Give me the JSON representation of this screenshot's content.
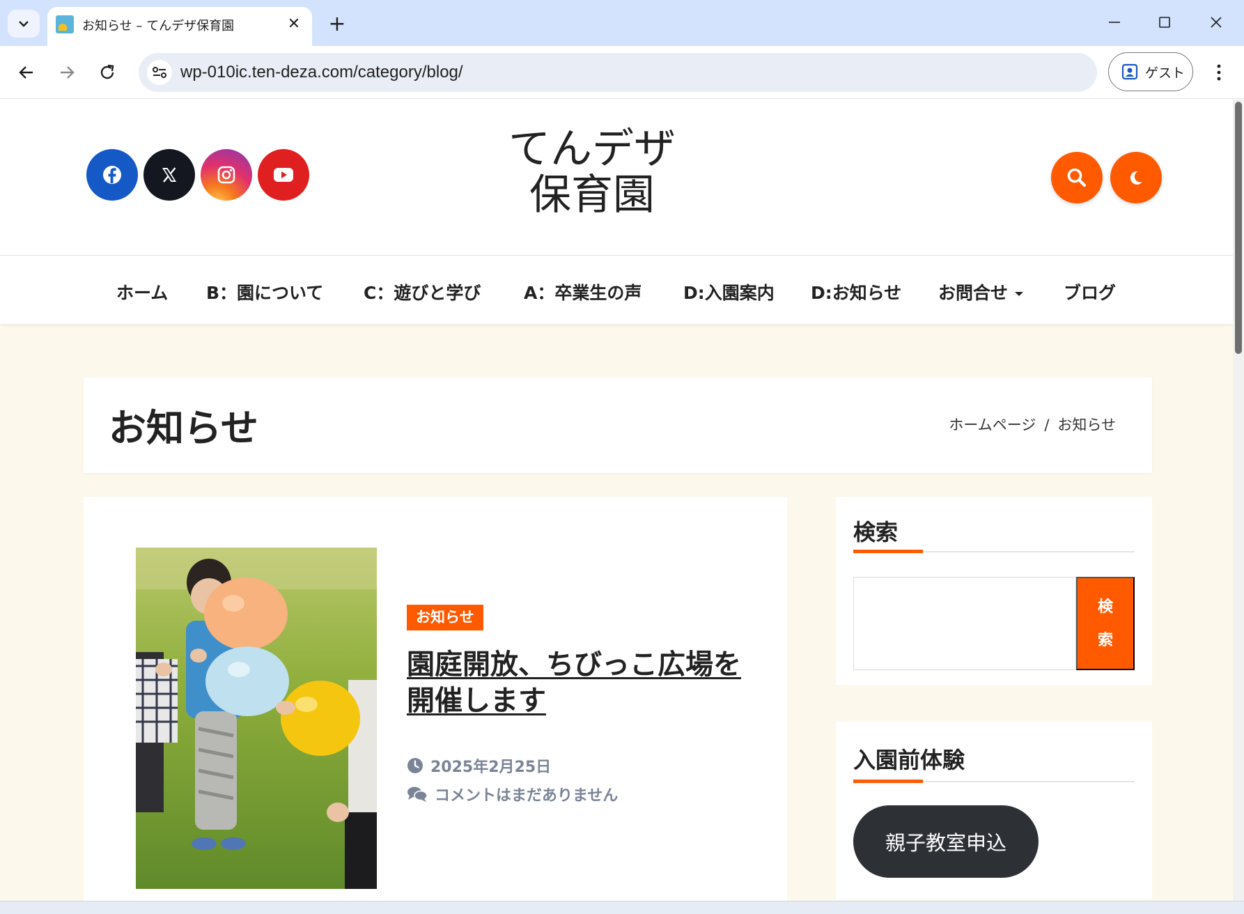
{
  "browser": {
    "tab_title": "お知らせ – てんデザ保育園",
    "tab_close_glyph": "✕",
    "new_tab_glyph": "+",
    "url": "wp-010ic.ten-deza.com/category/blog/",
    "profile_label": "ゲスト",
    "icons": [
      "tab-search-icon",
      "favicon-icon",
      "close-icon",
      "new-tab-icon",
      "minimize-icon",
      "maximize-icon",
      "window-close-icon",
      "back-icon",
      "forward-icon",
      "reload-icon",
      "site-info-icon",
      "profile-icon",
      "kebab-menu-icon"
    ]
  },
  "site": {
    "title_line1": "てんデザ",
    "title_line2": "保育園",
    "social": [
      "facebook-icon",
      "x-icon",
      "instagram-icon",
      "youtube-icon"
    ],
    "header_buttons": [
      "search-icon",
      "dark-mode-moon-icon"
    ]
  },
  "nav": {
    "items": [
      {
        "label": "ホーム"
      },
      {
        "label": "B：園について"
      },
      {
        "label": "C：遊びと学び"
      },
      {
        "label": "A：卒業生の声"
      },
      {
        "label": "D:入園案内"
      },
      {
        "label": "D:お知らせ"
      },
      {
        "label": "お問合せ",
        "has_dropdown": true
      },
      {
        "label": "ブログ"
      }
    ]
  },
  "page": {
    "title": "お知らせ",
    "breadcrumb": [
      {
        "label": "ホームページ"
      },
      {
        "label": "/"
      },
      {
        "label": "お知らせ"
      }
    ]
  },
  "post": {
    "category": "お知らせ",
    "title": "園庭開放、ちびっこ広場を開催します",
    "date": "2025年2月25日",
    "comments": "コメントはまだありません"
  },
  "sidebar": {
    "search_widget": {
      "title": "検索",
      "button_label": "検索",
      "input_value": ""
    },
    "trial_widget": {
      "title": "入園前体験",
      "button_label": "親子教室申込"
    }
  },
  "colors": {
    "accent": "#ff5a00",
    "page_bg": "#fcf8ec",
    "tabstrip": "#d3e3fd",
    "facebook": "#1559c7",
    "x": "#14171f",
    "youtube": "#e02020",
    "dark_button": "#2d3035",
    "meta_text": "#7a8497"
  }
}
